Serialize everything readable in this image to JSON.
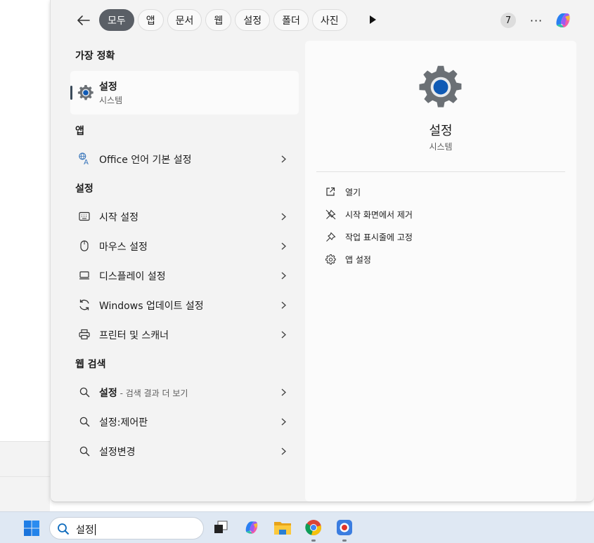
{
  "filters": [
    "모두",
    "앱",
    "문서",
    "웹",
    "설정",
    "폴더",
    "사진"
  ],
  "active_filter": "모두",
  "result_count": "7",
  "more_label": "···",
  "sections": {
    "best_match": "가장 정확",
    "apps": "앱",
    "settings": "설정",
    "web": "웹 검색"
  },
  "best_match": {
    "title": "설정",
    "subtitle": "시스템",
    "icon": "gear-icon"
  },
  "app_results": [
    {
      "label": "Office 언어 기본 설정",
      "icon": "office-language-icon"
    }
  ],
  "setting_results": [
    {
      "label": "시작 설정",
      "icon": "keyboard-icon"
    },
    {
      "label": "마우스 설정",
      "icon": "mouse-icon"
    },
    {
      "label": "디스플레이 설정",
      "icon": "display-icon"
    },
    {
      "label": "Windows 업데이트 설정",
      "icon": "refresh-icon"
    },
    {
      "label": "프린터 및 스캐너",
      "icon": "printer-icon"
    }
  ],
  "web_results": [
    {
      "label": "설정",
      "suffix": " - 검색 결과 더 보기",
      "icon": "search-icon"
    },
    {
      "label": "설정:제어판",
      "icon": "search-icon"
    },
    {
      "label": "설정변경",
      "icon": "search-icon"
    }
  ],
  "details": {
    "title": "설정",
    "subtitle": "시스템",
    "actions": [
      {
        "label": "열기",
        "icon": "open-external-icon"
      },
      {
        "label": "시작 화면에서 제거",
        "icon": "unpin-icon"
      },
      {
        "label": "작업 표시줄에 고정",
        "icon": "pin-icon"
      },
      {
        "label": "앱 설정",
        "icon": "gear-icon"
      }
    ]
  },
  "taskbar": {
    "search_value": "설정",
    "apps": [
      "task-view-icon",
      "copilot-icon",
      "file-explorer-icon",
      "chrome-icon",
      "recorder-icon"
    ]
  },
  "colors": {
    "accent": "#0f5ab5",
    "active_pill": "#5a5f66",
    "taskbar": "#dfe8f3"
  }
}
